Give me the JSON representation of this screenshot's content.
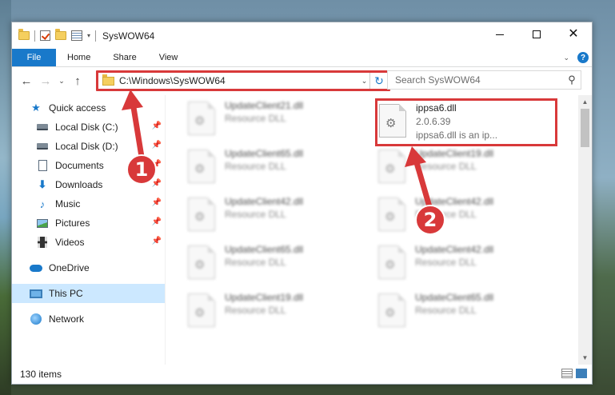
{
  "window": {
    "title": "SysWOW64"
  },
  "ribbon": {
    "tabs": [
      "File",
      "Home",
      "Share",
      "View"
    ],
    "help_label": "?"
  },
  "navbar": {
    "address": "C:\\Windows\\SysWOW64",
    "search_placeholder": "Search SysWOW64"
  },
  "sidebar": {
    "items": [
      {
        "label": "Quick access",
        "icon": "star-icon"
      },
      {
        "label": "Local Disk (C:)",
        "icon": "drive-icon"
      },
      {
        "label": "Local Disk (D:)",
        "icon": "drive-icon"
      },
      {
        "label": "Documents",
        "icon": "documents-icon"
      },
      {
        "label": "Downloads",
        "icon": "downloads-icon"
      },
      {
        "label": "Music",
        "icon": "music-icon"
      },
      {
        "label": "Pictures",
        "icon": "pictures-icon"
      },
      {
        "label": "Videos",
        "icon": "videos-icon"
      },
      {
        "label": "OneDrive",
        "icon": "onedrive-icon"
      },
      {
        "label": "This PC",
        "icon": "this-pc-icon"
      },
      {
        "label": "Network",
        "icon": "network-icon"
      }
    ]
  },
  "files": {
    "left_column": [
      {
        "name": "UpdateClient21.dll",
        "type": "Resource DLL"
      },
      {
        "name": "UpdateClient65.dll",
        "type": "Resource DLL"
      },
      {
        "name": "UpdateClient42.dll",
        "type": "Resource DLL"
      },
      {
        "name": "UpdateClient65.dll",
        "type": "Resource DLL"
      },
      {
        "name": "UpdateClient19.dll",
        "type": "Resource DLL"
      }
    ],
    "highlighted": {
      "name": "ippsa6.dll",
      "version": "2.0.6.39",
      "description": "ippsa6.dll is an ip..."
    },
    "right_column": [
      {
        "name": "UpdateClient19.dll",
        "type": "Resource DLL"
      },
      {
        "name": "UpdateClient42.dll",
        "type": "Resource DLL"
      },
      {
        "name": "UpdateClient42.dll",
        "type": "Resource DLL"
      },
      {
        "name": "UpdateClient65.dll",
        "type": "Resource DLL"
      }
    ]
  },
  "status": {
    "item_count": "130 items"
  },
  "annotations": {
    "badge1": "1",
    "badge2": "2",
    "color": "#d8393a"
  }
}
